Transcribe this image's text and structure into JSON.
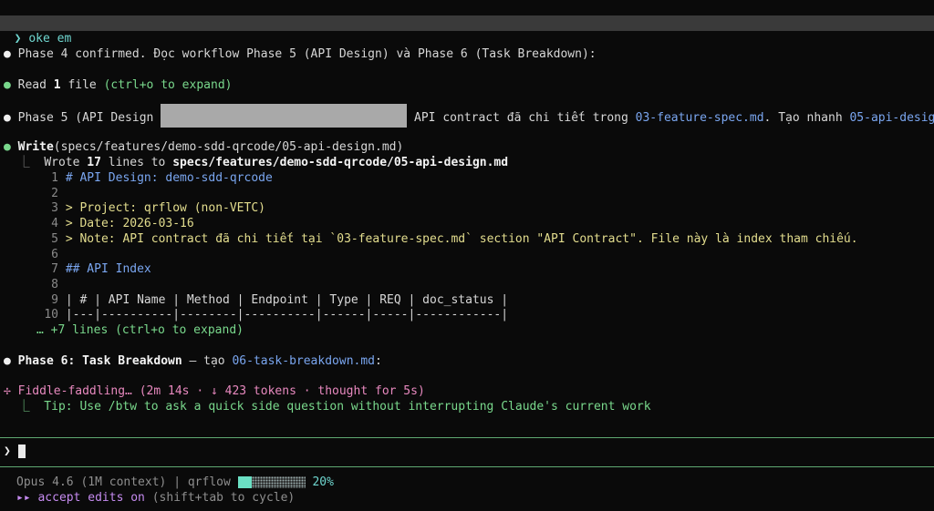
{
  "prompt_top": {
    "chevron": "❯",
    "text": "oke em"
  },
  "bullet": "●",
  "msg1": "Phase 4 confirmed. Đọc workflow Phase 5 (API Design) và Phase 6 (Task Breakdown):",
  "read": {
    "prefix": "Read ",
    "count": "1",
    "word": " file ",
    "hint": "(ctrl+o to expand)"
  },
  "phase5": {
    "prefix": "Phase 5 (API Design",
    "mid": " API contract đã chi tiết trong ",
    "file1": "03-feature-spec.md",
    "mid2": ". Tạo nhanh ",
    "file2": "05-api-design.md"
  },
  "write": {
    "tool": "Write",
    "args": "(specs/features/demo-sdd-qrcode/05-api-design.md)",
    "branch": "  ⎿  ",
    "wrote_prefix": "Wrote ",
    "count": "17",
    "wrote_mid": " lines to ",
    "path": "specs/features/demo-sdd-qrcode/05-api-design.md"
  },
  "file_lines": [
    {
      "n": "1",
      "text": "# API Design: demo-sdd-qrcode",
      "color": "blue"
    },
    {
      "n": "2",
      "text": "",
      "color": "white"
    },
    {
      "n": "3",
      "text": "> Project: qrflow (non-VETC)",
      "color": "yellow"
    },
    {
      "n": "4",
      "text": "> Date: 2026-03-16",
      "color": "yellow"
    },
    {
      "n": "5",
      "text": "> Note: API contract đã chi tiết tại `03-feature-spec.md` section \"API Contract\". File này là index tham chiếu.",
      "color": "yellow"
    },
    {
      "n": "6",
      "text": "",
      "color": "white"
    },
    {
      "n": "7",
      "text": "## API Index",
      "color": "blue"
    },
    {
      "n": "8",
      "text": "",
      "color": "white"
    },
    {
      "n": "9",
      "text": "| # | API Name | Method | Endpoint | Type | REQ | doc_status |",
      "color": "white"
    },
    {
      "n": "10",
      "text": "|---|----------|--------|----------|------|-----|------------|",
      "color": "white"
    }
  ],
  "more_lines": "… +7 lines (ctrl+o to expand)",
  "phase6": {
    "title": "Phase 6: Task Breakdown",
    "dash": " — tạo ",
    "file": "06-task-breakdown.md",
    "colon": ":"
  },
  "status": {
    "spinner": "✢",
    "text": "Fiddle-faddling… (2m 14s · ↓ 423 tokens · thought for 5s)",
    "tip": "  ⎿  Tip: Use /btw to ask a quick side question without interrupting Claude's current work"
  },
  "input": {
    "chevron": "❯"
  },
  "footer": {
    "model": "Opus 4.6 (1M context)",
    "sep": " | ",
    "project": "qrflow ",
    "percent": "20%",
    "progress": 0.2,
    "mode_icon": "▸▸",
    "mode": " accept edits on ",
    "mode_hint": "(shift+tab to cycle)"
  },
  "colors": {
    "accent": "#6fd6cf",
    "bg": "#0a0a0a",
    "rule": "#5fa872"
  }
}
